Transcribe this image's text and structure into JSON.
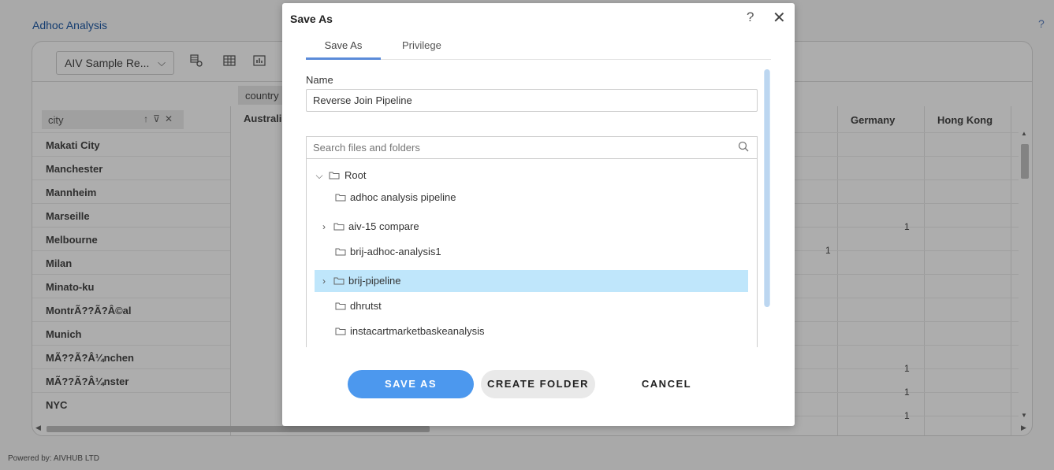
{
  "app": {
    "title": "Adhoc Analysis",
    "help": "?",
    "powered_by": "Powered by: AIVHUB LTD"
  },
  "toolbar": {
    "datasource_select": "AIV Sample Re..."
  },
  "grid": {
    "country_chip": "country",
    "city_chip": "city",
    "first_column_header": "Australi",
    "right_headers": [
      "Germany",
      "Hong Kong"
    ],
    "cities": [
      "Makati City",
      "Manchester",
      "Mannheim",
      "Marseille",
      "Melbourne",
      "Milan",
      "Minato-ku",
      "MontrÃ??Ã?Â©al",
      "Munich",
      "MÃ??Ã?Â¼nchen",
      "MÃ??Ã?Â¼nster",
      "NYC"
    ],
    "values": {
      "mannheim_germany": "1",
      "marseille_france": "1",
      "munich_germany": "1",
      "munchen_germany": "1",
      "munster_germany": "1"
    }
  },
  "dialog": {
    "title": "Save As",
    "help": "?",
    "close": "✕",
    "tabs": [
      "Save As",
      "Privilege"
    ],
    "name_label": "Name",
    "name_value": "Reverse Join Pipeline",
    "search_placeholder": "Search files and folders",
    "tree": {
      "root": "Root",
      "items": [
        {
          "label": "adhoc analysis pipeline",
          "expandable": false,
          "selected": false
        },
        {
          "label": "aiv-15 compare",
          "expandable": true,
          "selected": false
        },
        {
          "label": "brij-adhoc-analysis1",
          "expandable": false,
          "selected": false
        },
        {
          "label": "brij-pipeline",
          "expandable": true,
          "selected": true
        },
        {
          "label": "dhrutst",
          "expandable": false,
          "selected": false
        },
        {
          "label": "instacartmarketbaskeanalysis",
          "expandable": false,
          "selected": false
        }
      ]
    },
    "buttons": {
      "save_as": "SAVE AS",
      "create_folder": "CREATE FOLDER",
      "cancel": "CANCEL"
    }
  },
  "icons": {
    "chevron_down": "chevron-down-icon",
    "chevron_right": "chevron-right-icon",
    "folder": "folder-icon",
    "search": "search-icon"
  },
  "colors": {
    "accent": "#4c98ee",
    "selected_row": "#bfe6fb",
    "tab_underline": "#5b8bd9"
  }
}
